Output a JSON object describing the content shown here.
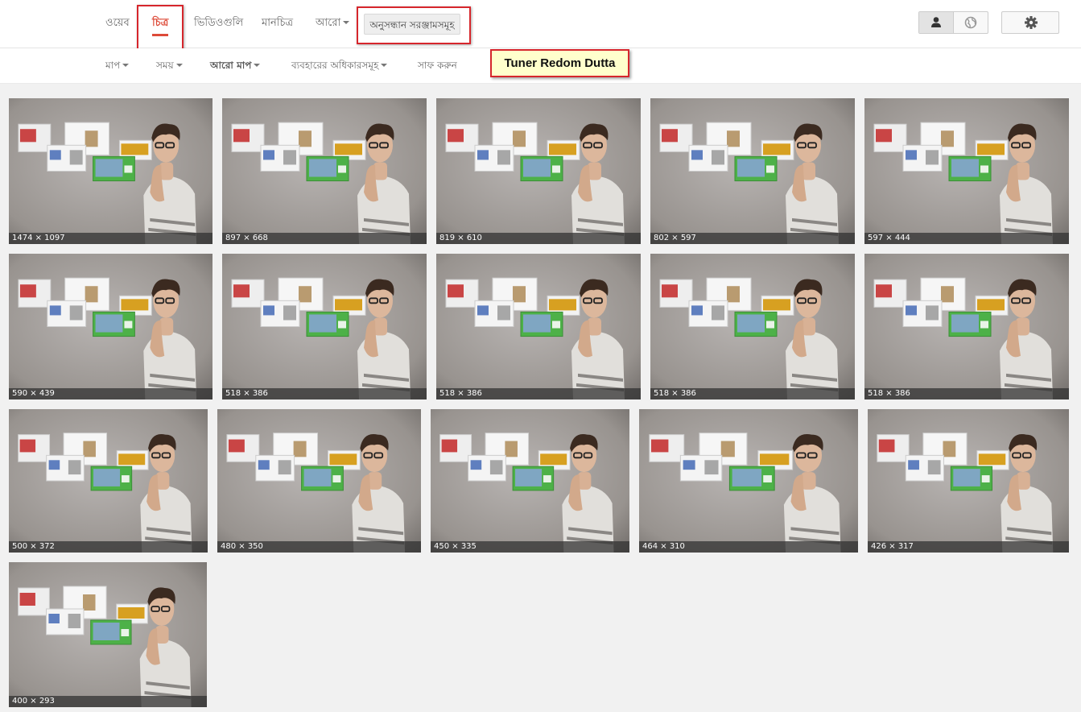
{
  "nav": {
    "tabs": [
      {
        "label": "ওয়েব"
      },
      {
        "label": "চিত্র"
      },
      {
        "label": "ভিডিওগুলি"
      },
      {
        "label": "মানচিত্র"
      },
      {
        "label": "আরো"
      }
    ],
    "search_tools_label": "অনুসন্ধান সরঞ্জামসমূহ"
  },
  "filters": [
    {
      "label": "মাপ"
    },
    {
      "label": "সময়"
    },
    {
      "label": "আরো মাপ"
    },
    {
      "label": "ব্যবহারের অধিকারসমূহ"
    },
    {
      "label": "সাফ করুন"
    }
  ],
  "annotation": "Tuner Redom Dutta",
  "results": [
    {
      "dims": "1474 × 1097"
    },
    {
      "dims": "897 × 668"
    },
    {
      "dims": "819 × 610"
    },
    {
      "dims": "802 × 597"
    },
    {
      "dims": "597 × 444"
    },
    {
      "dims": "590 × 439"
    },
    {
      "dims": "518 × 386"
    },
    {
      "dims": "518 × 386"
    },
    {
      "dims": "518 × 386"
    },
    {
      "dims": "518 × 386"
    },
    {
      "dims": "500 × 372"
    },
    {
      "dims": "480 × 350"
    },
    {
      "dims": "450 × 335"
    },
    {
      "dims": "464 × 310"
    },
    {
      "dims": "426 × 317"
    },
    {
      "dims": "400 × 293"
    }
  ],
  "colors": {
    "accent": "#dd4b39",
    "highlight_border": "#d6262c",
    "note_bg": "#ffffcc"
  },
  "icons": {
    "account": "person-icon",
    "safe": "globe-icon",
    "settings": "gear-icon"
  }
}
